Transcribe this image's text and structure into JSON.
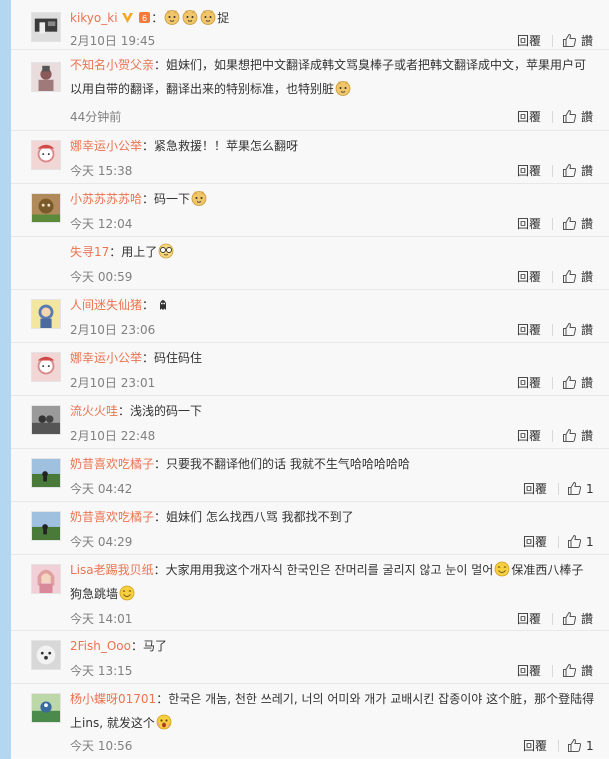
{
  "comments": [
    {
      "name": "kikyo_ki",
      "badges": [
        "v-badge-icon",
        "level-badge-icon"
      ],
      "text_before": "：",
      "emoji_after": [
        "doge-icon",
        "doge-icon",
        "doge-icon"
      ],
      "text_after": "捉",
      "time": "2月10日 19:45",
      "reply": "回覆",
      "like": "讚",
      "avatar_color": "#3a3a3a"
    },
    {
      "name": "不知名小贺父亲",
      "text_before": "：姐妹们，如果想把中文翻译成韩文骂臭棒子或者把韩文翻译成中文，苹果用户可以用自带的翻译，翻译出来的特别标准，也特别脏",
      "emoji_after": [
        "doge-icon"
      ],
      "text_after": "",
      "time": "44分钟前",
      "reply": "回覆",
      "like": "讚",
      "avatar_color": "#b08a8a"
    },
    {
      "name": "娜幸运小公举",
      "text_before": "：紧急救援！！苹果怎么翻呀",
      "time": "今天 15:38",
      "reply": "回覆",
      "like": "讚",
      "avatar_color": "#d98a8a"
    },
    {
      "name": "小苏苏苏苏哈",
      "text_before": "：码一下",
      "emoji_after": [
        "doge-icon"
      ],
      "time": "今天 12:04",
      "reply": "回覆",
      "like": "讚",
      "avatar_color": "#8a6a3a"
    },
    {
      "name": "失寻17",
      "text_before": "：用上了",
      "emoji_after": [
        "glasses-face-icon"
      ],
      "time": "今天 00:59",
      "reply": "回覆",
      "like": "讚",
      "avatar_color": ""
    },
    {
      "name": "人间迷失仙猪",
      "text_before": "：",
      "emoji_after": [
        "ghost-icon"
      ],
      "time": "2月10日 23:06",
      "reply": "回覆",
      "like": "讚",
      "avatar_color": "#e8d46a"
    },
    {
      "name": "娜幸运小公举",
      "text_before": "：码住码住",
      "time": "2月10日 23:01",
      "reply": "回覆",
      "like": "讚",
      "avatar_color": "#d98a8a"
    },
    {
      "name": "流火火哇",
      "text_before": "：浅浅的码一下",
      "time": "2月10日 22:48",
      "reply": "回覆",
      "like": "讚",
      "avatar_color": "#6a6a6a"
    },
    {
      "name": "奶昔喜欢吃橘子",
      "text_before": "：只要我不翻译他们的话 我就不生气哈哈哈哈哈",
      "time": "今天 04:42",
      "reply": "回覆",
      "like": "1",
      "avatar_color": "#5a7a4a"
    },
    {
      "name": "奶昔喜欢吃橘子",
      "text_before": "：姐妹们 怎么找西八骂 我都找不到了",
      "time": "今天 04:29",
      "reply": "回覆",
      "like": "1",
      "avatar_color": "#5a7a4a"
    },
    {
      "name": "Lisa老踢我贝纸",
      "text_before": "：大家用用我这个개자식 한국인은 잔머리를 굴리지 않고 눈이 멀어",
      "emoji_after": [
        "smile-icon"
      ],
      "text_after": "保准西八棒子狗急跳墙",
      "emoji_end": [
        "smile-icon"
      ],
      "time": "今天 14:01",
      "reply": "回覆",
      "like": "讚",
      "avatar_color": "#e0a0a0"
    },
    {
      "name": "2Fish_Ooo",
      "text_before": "：马了",
      "time": "今天 13:15",
      "reply": "回覆",
      "like": "讚",
      "avatar_color": "#c8c8c8"
    },
    {
      "name": "杨小蝶呀01701",
      "text_before": "：한국은 개놈, 천한 쓰레기, 너의 어미와 개가 교배시킨 잡종이야 这个脏，那个登陆得上ins, 就发这个",
      "emoji_after": [
        "shock-face-icon"
      ],
      "time": "今天 10:56",
      "reply": "回覆",
      "like": "1",
      "avatar_color": "#4a8a4a"
    }
  ]
}
